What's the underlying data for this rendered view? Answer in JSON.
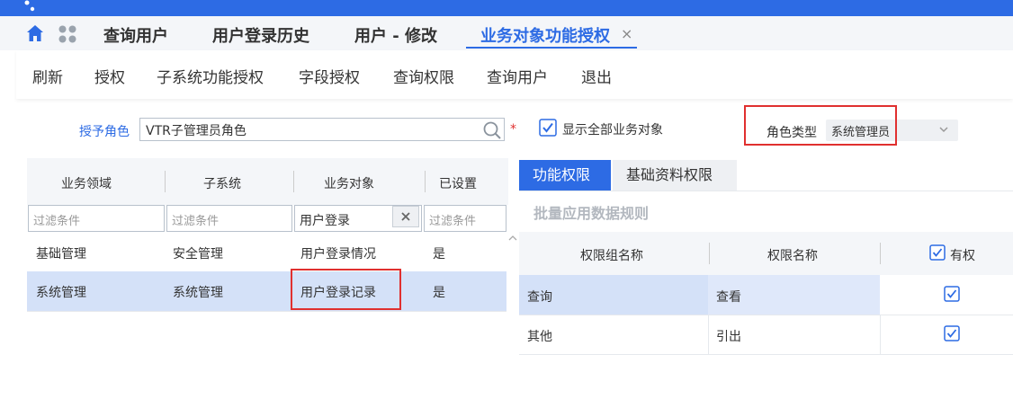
{
  "tabs": [
    {
      "label": "查询用户"
    },
    {
      "label": "用户登录历史"
    },
    {
      "label": "用户 - 修改"
    },
    {
      "label": "业务对象功能授权"
    }
  ],
  "tab_close": "×",
  "toolbar": [
    "刷新",
    "授权",
    "子系统功能授权",
    "字段授权",
    "查询权限",
    "查询用户",
    "退出"
  ],
  "form": {
    "role_label": "授予角色",
    "role_value": "VTR子管理员角色",
    "required_mark": "*",
    "show_all_label": "显示全部业务对象",
    "show_all_checked": true,
    "role_type_label": "角色类型",
    "role_type_value": "系统管理员"
  },
  "left_table": {
    "headers": [
      "业务领域",
      "子系统",
      "业务对象",
      "已设置"
    ],
    "filters": [
      "过滤条件",
      "过滤条件",
      "用户登录",
      "过滤条件"
    ],
    "clear_icon": "×",
    "rows": [
      [
        "基础管理",
        "安全管理",
        "用户登录情况",
        "是"
      ],
      [
        "系统管理",
        "系统管理",
        "用户登录记录",
        "是"
      ]
    ],
    "selected_row": 1
  },
  "right_panel": {
    "tabs": [
      "功能权限",
      "基础资料权限"
    ],
    "batch_label": "批量应用数据规则",
    "headers": [
      "权限组名称",
      "权限名称",
      "有权"
    ],
    "rows": [
      {
        "group": "查询",
        "name": "查看",
        "granted": true
      },
      {
        "group": "其他",
        "name": "引出",
        "granted": true
      }
    ],
    "selected_row": 0
  },
  "colors": {
    "accent": "#2d6be4",
    "highlight": "#e0302f",
    "selected_row": "#d4e1f8"
  }
}
